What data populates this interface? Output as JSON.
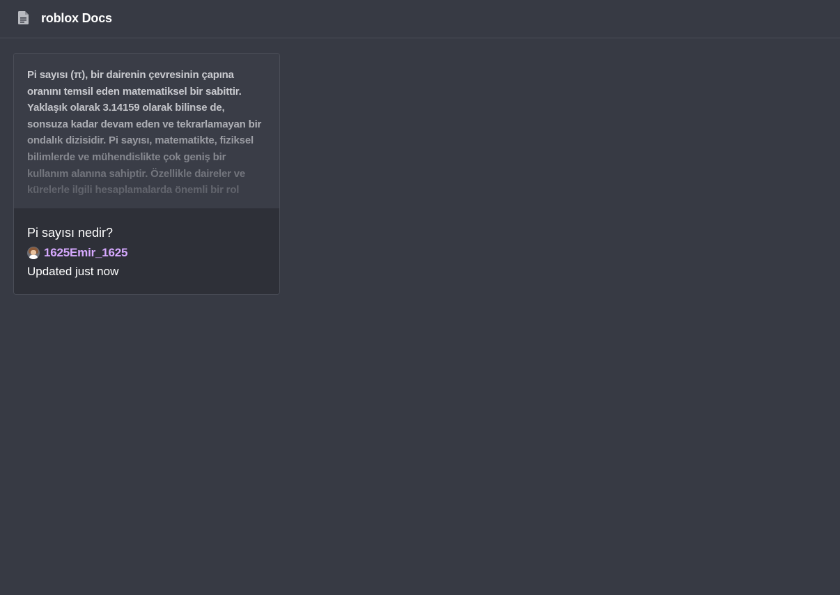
{
  "header": {
    "icon": "document-icon",
    "title": "roblox Docs"
  },
  "documents": [
    {
      "preview_text": "Pi sayısı (π), bir dairenin çevresinin çapına oranını temsil eden matematiksel bir sabittir. Yaklaşık olarak 3.14159 olarak bilinse de, sonsuza kadar devam eden ve tekrarlamayan bir ondalık dizisidir. Pi sayısı, matematikte, fiziksel bilimlerde ve mühendislikte çok geniş bir kullanım alanına sahiptir. Özellikle daireler ve kürelerle ilgili hesaplamalarda önemli bir rol",
      "title": "Pi sayısı nedir?",
      "author": "1625Emir_1625",
      "updated": "Updated just now"
    }
  ],
  "colors": {
    "background": "#373a44",
    "card_info": "#2e3038",
    "preview": "#3a3d47",
    "author": "#d6a9ff",
    "text": "#ffffff"
  }
}
